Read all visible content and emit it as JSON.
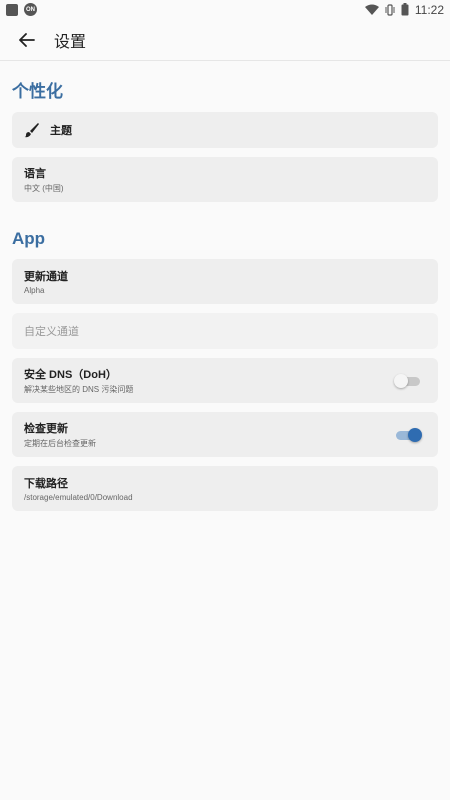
{
  "status_bar": {
    "badge": "ON",
    "time": "11:22"
  },
  "appbar": {
    "title": "设置"
  },
  "sections": [
    {
      "title": "个性化",
      "items": [
        {
          "title": "主题",
          "icon": "brush-icon"
        },
        {
          "title": "语言",
          "subtitle": "中文 (中国)"
        }
      ]
    },
    {
      "title": "App",
      "items": [
        {
          "title": "更新通道",
          "subtitle": "Alpha"
        },
        {
          "placeholder": "自定义通道"
        },
        {
          "title": "安全 DNS（DoH）",
          "subtitle": "解决某些地区的 DNS 污染问题",
          "toggle": false
        },
        {
          "title": "检查更新",
          "subtitle": "定期在后台检查更新",
          "toggle": true
        },
        {
          "title": "下载路径",
          "subtitle": "/storage/emulated/0/Download"
        }
      ]
    }
  ],
  "colors": {
    "accent": "#3b6ea1",
    "switch_on": "#2f6cb1"
  }
}
